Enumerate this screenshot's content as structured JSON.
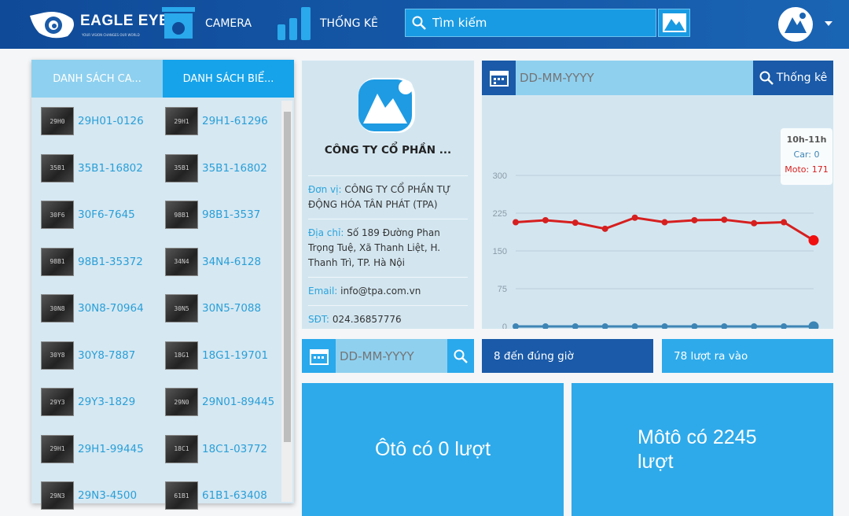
{
  "header": {
    "logo": "EAGLE EYE",
    "logo_tagline": "YOUR VISION CHANGES OUR WORLD",
    "nav": [
      {
        "label": "CAMERA",
        "icon": "camera-icon"
      },
      {
        "label": "THỐNG KÊ",
        "icon": "bar-chart-icon"
      }
    ],
    "search_placeholder": "Tìm kiếm"
  },
  "left_panel": {
    "tabs": [
      "DANH SÁCH CA...",
      "DANH SÁCH BIỂ..."
    ],
    "active_tab": 1,
    "col1": [
      "29H01-0126",
      "35B1-16802",
      "30F6-7645",
      "98B1-35372",
      "30N8-70964",
      "30Y8-7887",
      "29Y3-1829",
      "29H1-99445",
      "29N3-4500"
    ],
    "col2": [
      "29H1-61296",
      "35B1-16802",
      "98B1-3537",
      "34N4-6128",
      "30N5-7088",
      "18G1-19701",
      "29N01-89445",
      "18C1-03772",
      "61B1-63408"
    ]
  },
  "company": {
    "name": "CÔNG TY CỔ PHẦN ...",
    "fields": [
      {
        "label": "Đơn vị:",
        "value": "CÔNG TY CỔ PHẦN TỰ ĐỘNG HÓA TÂN PHÁT (TPA)"
      },
      {
        "label": "Địa chỉ:",
        "value": "Số 189 Đường Phan Trọng Tuệ, Xã Thanh Liệt, H. Thanh Trì, TP. Hà Nội"
      },
      {
        "label": "Email:",
        "value": "info@tpa.com.vn"
      },
      {
        "label": "SĐT:",
        "value": "024.36857776"
      }
    ]
  },
  "chart_panel": {
    "date_placeholder": "DD-MM-YYYY",
    "button": "Thống kê"
  },
  "chart_data": {
    "type": "line",
    "ylim": [
      0,
      300
    ],
    "yticks": [
      0,
      75,
      150,
      225,
      300
    ],
    "grid": true,
    "series": [
      {
        "name": "Moto",
        "color": "#d61f1f",
        "values": [
          207,
          211,
          206,
          194,
          216,
          207,
          211,
          212,
          205,
          207,
          171
        ]
      },
      {
        "name": "Car",
        "color": "#3d85b5",
        "values": [
          0,
          0,
          0,
          0,
          0,
          0,
          0,
          0,
          0,
          0,
          0
        ]
      }
    ],
    "tooltip": {
      "title": "10h-11h",
      "car": "Car: 0",
      "moto": "Moto: 171"
    }
  },
  "stats": {
    "date_placeholder": "DD-MM-YYYY",
    "on_time": "8 đến đúng giờ",
    "entries": "78 lượt ra vào",
    "car": "Ôtô có 0 lượt",
    "moto": "Môtô có 2245 lượt"
  }
}
